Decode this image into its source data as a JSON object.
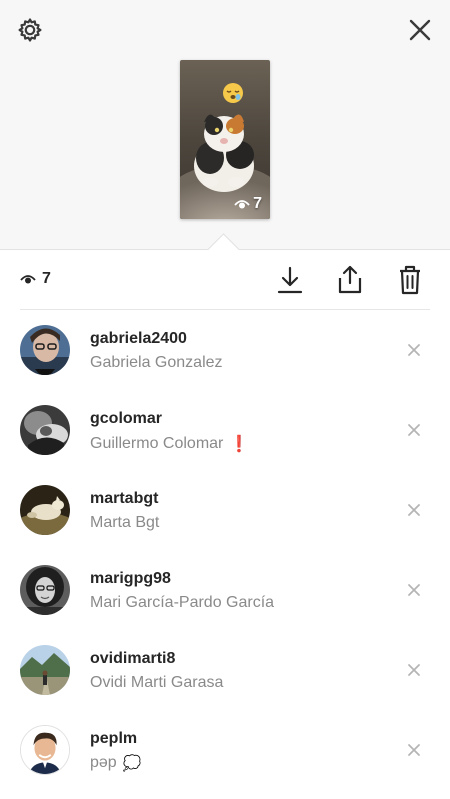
{
  "viewer": {
    "views_count": "7",
    "thumb_views_count": "7"
  },
  "icons": {
    "settings": "gear-icon",
    "close": "close-icon",
    "download": "download-icon",
    "share": "share-icon",
    "delete": "trash-icon",
    "eye": "eye-icon",
    "sticker": "sleepy-emoji-sticker"
  },
  "colors": {
    "username": "#262626",
    "fullname": "#8a8a8a",
    "icon": "#3a3a3a",
    "remove_x": "#b5b5b5",
    "top_background": "#f7f7f7"
  },
  "viewers": [
    {
      "username": "gabriela2400",
      "full_name": "Gabriela Gonzalez",
      "suffix": ""
    },
    {
      "username": "gcolomar",
      "full_name": "Guillermo Colomar",
      "suffix": "❗"
    },
    {
      "username": "martabgt",
      "full_name": "Marta Bgt",
      "suffix": ""
    },
    {
      "username": "marigpg98",
      "full_name": "Mari García-Pardo García",
      "suffix": ""
    },
    {
      "username": "ovidimarti8",
      "full_name": "Ovidi Marti Garasa",
      "suffix": ""
    },
    {
      "username": "peplm",
      "full_name": "pəp",
      "suffix": "💭"
    }
  ]
}
